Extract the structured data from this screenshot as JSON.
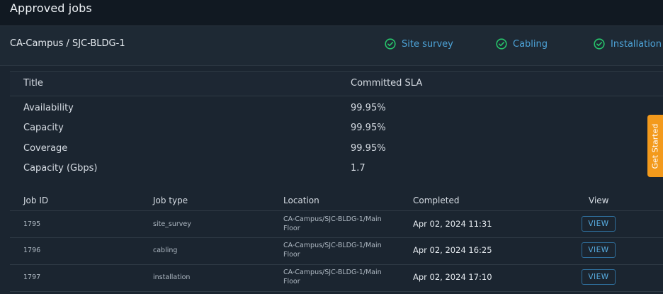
{
  "page": {
    "title": "Approved jobs"
  },
  "site": {
    "name": "CA-Campus / SJC-BLDG-1",
    "steps": [
      {
        "label": "Site survey",
        "icon": "check-circle-icon",
        "status": "complete"
      },
      {
        "label": "Cabling",
        "icon": "check-circle-icon",
        "status": "complete"
      },
      {
        "label": "Installation",
        "icon": "check-circle-icon",
        "status": "complete"
      }
    ]
  },
  "sla": {
    "headers": {
      "title": "Title",
      "committed": "Committed SLA"
    },
    "rows": [
      {
        "title": "Availability",
        "value": "99.95%"
      },
      {
        "title": "Capacity",
        "value": "99.95%"
      },
      {
        "title": "Coverage",
        "value": "99.95%"
      },
      {
        "title": "Capacity (Gbps)",
        "value": "1.7"
      }
    ]
  },
  "jobs": {
    "headers": {
      "job_id": "Job ID",
      "job_type": "Job type",
      "location": "Location",
      "completed": "Completed",
      "view": "View"
    },
    "rows": [
      {
        "job_id": "1795",
        "job_type": "site_survey",
        "location_line1": "CA-Campus/SJC-BLDG-1/Main",
        "location_line2": "Floor",
        "completed": "Apr 02, 2024 11:31",
        "view_label": "VIEW"
      },
      {
        "job_id": "1796",
        "job_type": "cabling",
        "location_line1": "CA-Campus/SJC-BLDG-1/Main",
        "location_line2": "Floor",
        "completed": "Apr 02, 2024 16:25",
        "view_label": "VIEW"
      },
      {
        "job_id": "1797",
        "job_type": "installation",
        "location_line1": "CA-Campus/SJC-BLDG-1/Main",
        "location_line2": "Floor",
        "completed": "Apr 02, 2024 17:10",
        "view_label": "VIEW"
      }
    ]
  },
  "get_started": {
    "label": "Get Started"
  },
  "colors": {
    "background": "#121a24",
    "accent": "#4da3d8",
    "success": "#27c46b",
    "cta": "#f39a1c"
  }
}
